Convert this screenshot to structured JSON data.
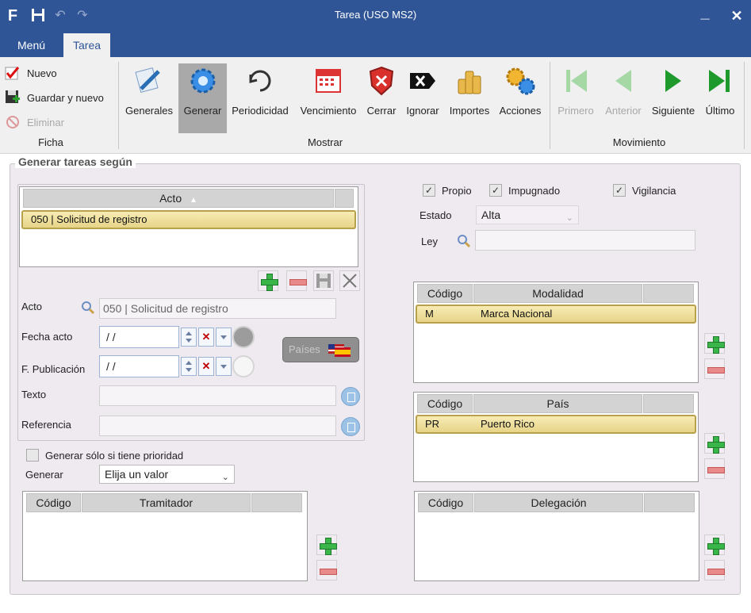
{
  "window": {
    "title": "Tarea (USO MS2)"
  },
  "tabs": [
    {
      "label": "Menú"
    },
    {
      "label": "Tarea"
    }
  ],
  "ribbon": {
    "ficha": {
      "nuevo": "Nuevo",
      "guardar_nuevo": "Guardar y nuevo",
      "eliminar": "Eliminar",
      "group": "Ficha"
    },
    "mostrar": {
      "group": "Mostrar",
      "buttons": [
        "Generales",
        "Generar",
        "Periodicidad",
        "Vencimiento",
        "Cerrar",
        "Ignorar",
        "Importes",
        "Acciones"
      ]
    },
    "movimiento": {
      "group": "Movimiento",
      "buttons": [
        "Primero",
        "Anterior",
        "Siguiente",
        "Último"
      ]
    }
  },
  "panel": {
    "title": "Generar tareas según",
    "acto_grid": {
      "header": "Acto",
      "rows": [
        "050 | Solicitud de registro"
      ]
    },
    "acto": {
      "label": "Acto",
      "value": "050 | Solicitud de registro"
    },
    "fecha_acto": {
      "label": "Fecha acto",
      "value": "/  /"
    },
    "f_publicacion": {
      "label": "F. Publicación",
      "value": "/  /"
    },
    "paises_button": "Países",
    "texto": {
      "label": "Texto",
      "value": ""
    },
    "referencia": {
      "label": "Referencia",
      "value": ""
    },
    "prioridad": {
      "label": "Generar sólo si tiene prioridad",
      "checked": false
    },
    "generar": {
      "label": "Generar",
      "selected": "Elija un valor"
    },
    "tramitador_grid": {
      "headers": [
        "Código",
        "Tramitador"
      ],
      "rows": []
    },
    "checks": [
      {
        "label": "Propio",
        "checked": true
      },
      {
        "label": "Impugnado",
        "checked": true
      },
      {
        "label": "Vigilancia",
        "checked": true
      }
    ],
    "estado": {
      "label": "Estado",
      "selected": "Alta"
    },
    "ley": {
      "label": "Ley",
      "value": ""
    },
    "modalidad_grid": {
      "headers": [
        "Código",
        "Modalidad"
      ],
      "rows": [
        {
          "codigo": "M",
          "valor": "Marca Nacional"
        }
      ]
    },
    "pais_grid": {
      "headers": [
        "Código",
        "País"
      ],
      "rows": [
        {
          "codigo": "PR",
          "valor": "Puerto Rico"
        }
      ]
    },
    "delegacion_grid": {
      "headers": [
        "Código",
        "Delegación"
      ],
      "rows": []
    }
  },
  "colors": {
    "titlebar": "#2f5597",
    "panel_bg": "#efe9f0",
    "row_highlight": "#f0df9b",
    "pressed": "#a9a9a9"
  }
}
